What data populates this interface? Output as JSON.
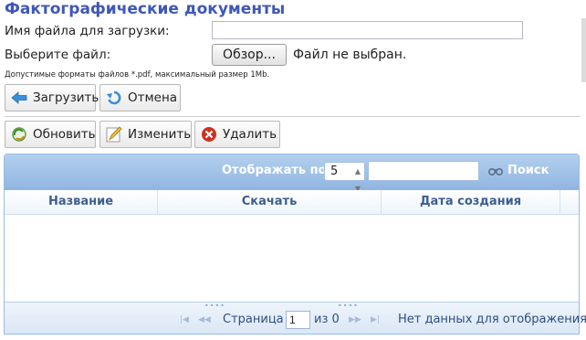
{
  "page": {
    "title": "Фактографические документы"
  },
  "upload": {
    "filename_label": "Имя файла для загрузки:",
    "filename_value": "",
    "choose_label": "Выберите файл:",
    "browse_label": "Обзор...",
    "no_file_text": "Файл не выбран.",
    "hint": "Допустимые форматы файлов *.pdf, максимальный размер 1Mb.",
    "upload_btn": "Загрузить",
    "cancel_btn": "Отмена"
  },
  "toolbar": {
    "refresh_btn": "Обновить",
    "edit_btn": "Изменить",
    "delete_btn": "Удалить"
  },
  "grid": {
    "show_by_label": "Отображать по:",
    "per_page": "5",
    "search_value": "",
    "search_label": "Поиск",
    "columns": [
      "Название",
      "Скачать",
      "Дата создания"
    ],
    "rows": []
  },
  "pager": {
    "page_label": "Страница",
    "page_value": "1",
    "of_label": "из 0",
    "empty_text": "Нет данных для отображения"
  },
  "colors": {
    "title": "#3f57b8",
    "header_blue": "#99bbe8",
    "column_text": "#3d5f91",
    "delete_red": "#d0311f"
  }
}
